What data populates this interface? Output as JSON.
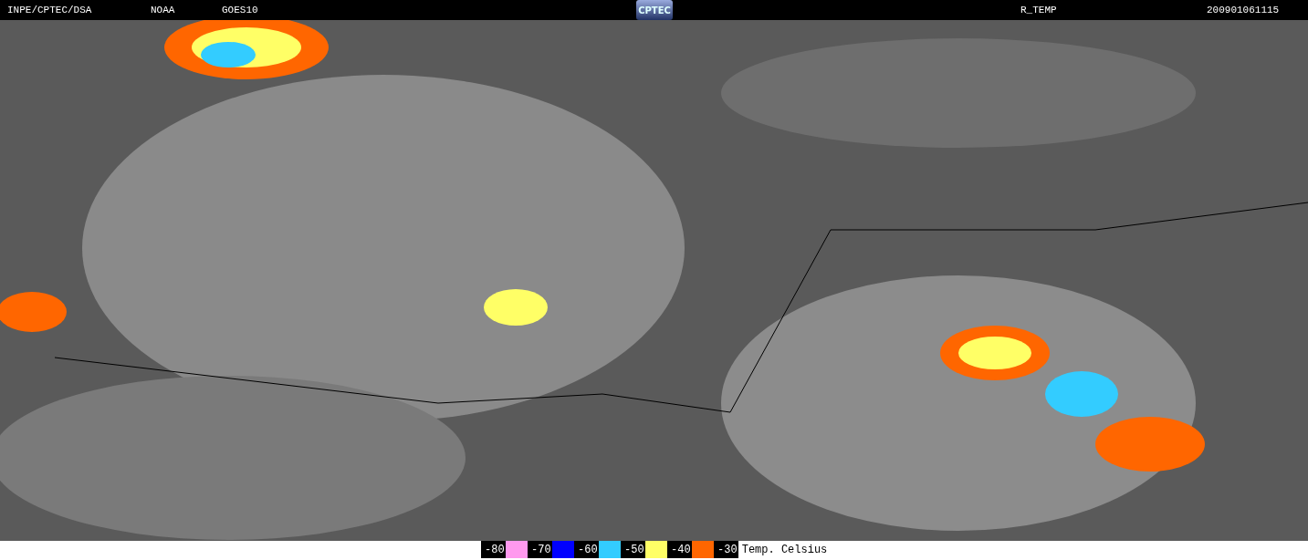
{
  "header": {
    "source": "INPE/CPTEC/DSA",
    "agency": "NOAA",
    "satellite": "GOES10",
    "logo": "CPTEC",
    "product": "R_TEMP",
    "timestamp": "200901061115"
  },
  "legend": {
    "steps": [
      {
        "label": "-80",
        "color": "#ff99ee"
      },
      {
        "label": "-70",
        "color": "#0000ff"
      },
      {
        "label": "-60",
        "color": "#33ccff"
      },
      {
        "label": "-50",
        "color": "#ffff66"
      },
      {
        "label": "-40",
        "color": "#ff6600"
      },
      {
        "label": "-30"
      }
    ],
    "caption": "Temp. Celsius"
  }
}
